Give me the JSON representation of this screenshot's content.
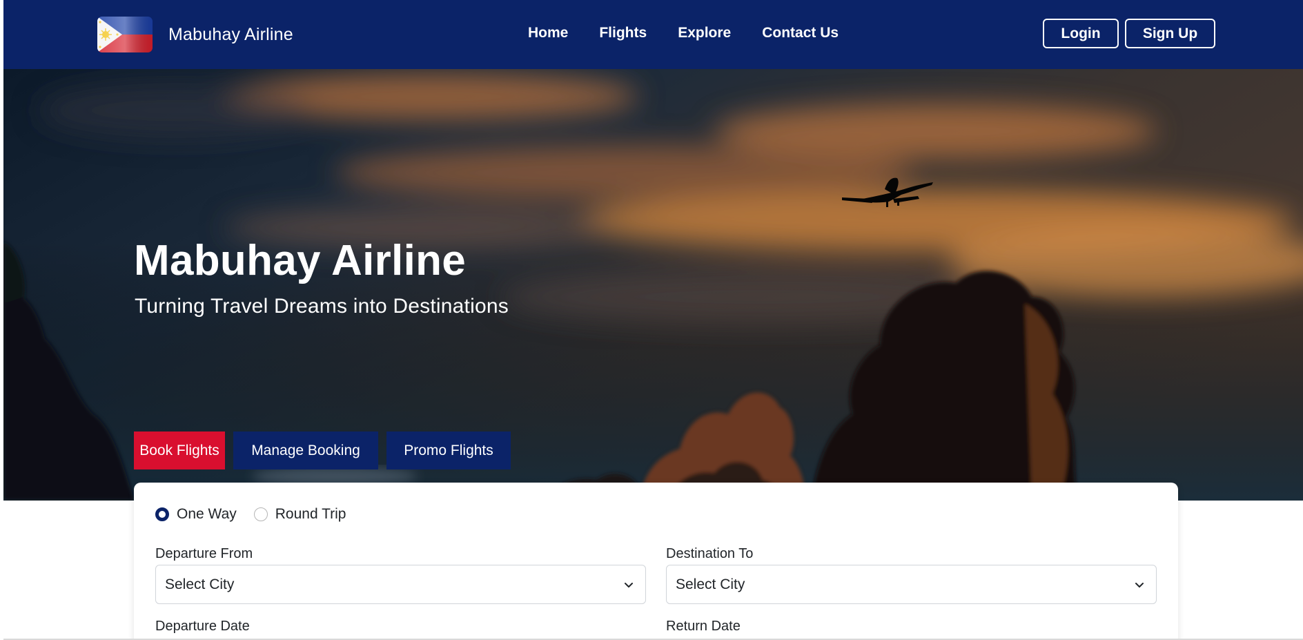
{
  "navbar": {
    "brand": "Mabuhay Airline",
    "links": [
      "Home",
      "Flights",
      "Explore",
      "Contact Us"
    ],
    "login": "Login",
    "signup": "Sign Up"
  },
  "hero": {
    "title": "Mabuhay Airline",
    "subtitle": "Turning Travel Dreams into Destinations"
  },
  "tabs": [
    "Book Flights",
    "Manage Booking",
    "Promo Flights"
  ],
  "booking_form": {
    "trip_types": [
      {
        "label": "One Way",
        "checked": true
      },
      {
        "label": "Round Trip",
        "checked": false
      }
    ],
    "departure_from": {
      "label": "Departure From",
      "value": "Select City"
    },
    "destination_to": {
      "label": "Destination To",
      "value": "Select City"
    },
    "departure_date": {
      "label": "Departure Date"
    },
    "return_date": {
      "label": "Return Date"
    }
  },
  "colors": {
    "navy": "#0b2368",
    "accent_red": "#d90f2f",
    "white": "#ffffff"
  }
}
